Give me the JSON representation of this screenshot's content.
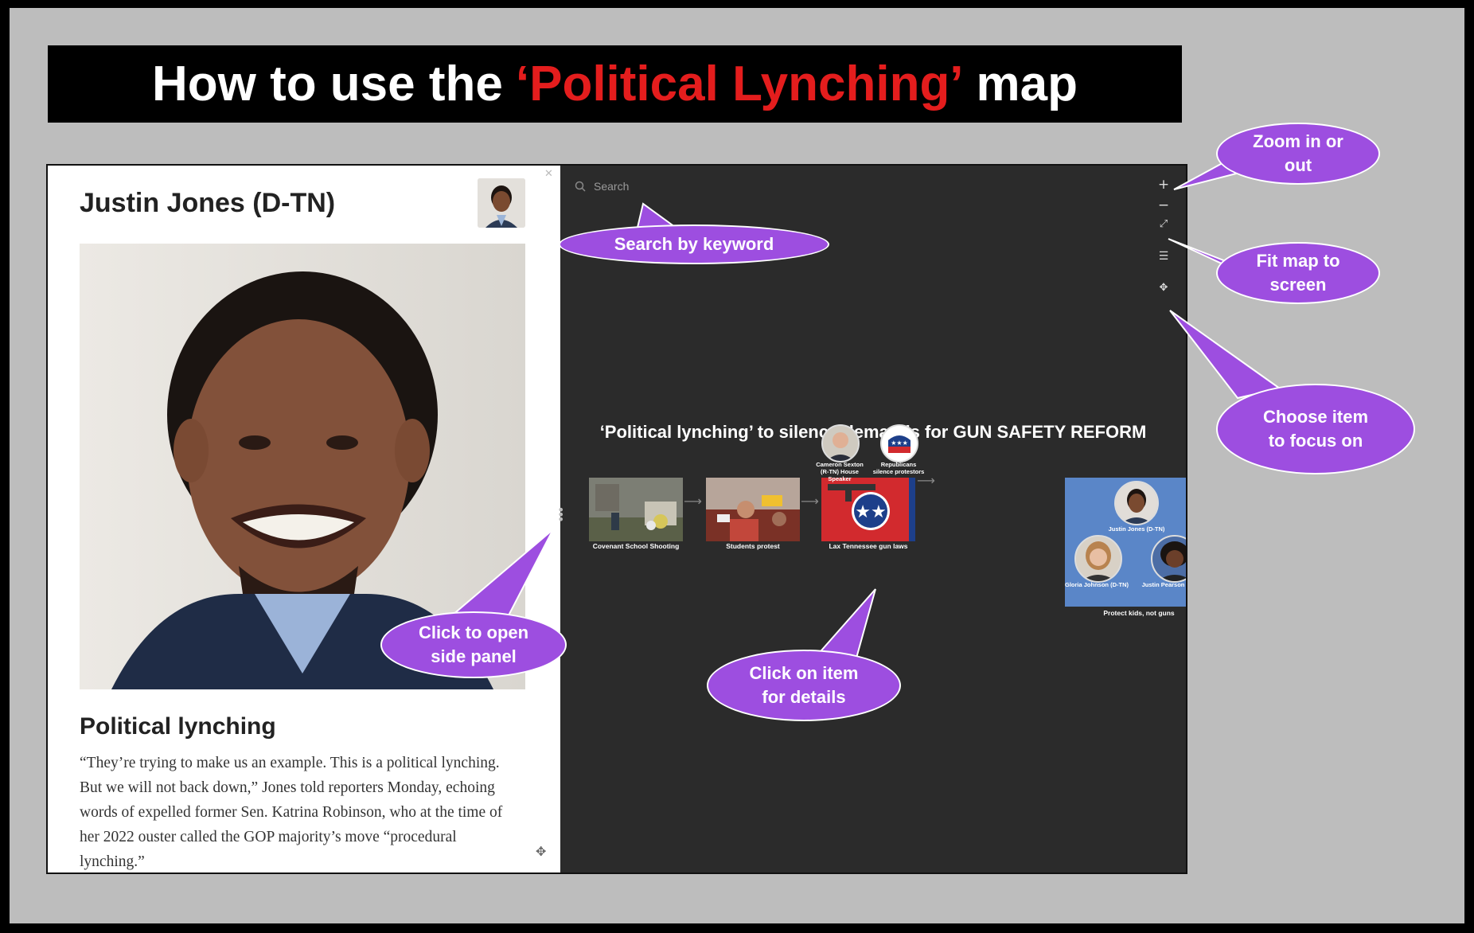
{
  "banner": {
    "prefix": "How to use the",
    "highlight": "‘Political Lynching’",
    "suffix": "map"
  },
  "side_panel": {
    "name": "Justin Jones (D-TN)",
    "close_icon": "close-icon",
    "section_title": "Political lynching",
    "quote": "“They’re trying to make us an example. This is a political lynching. But we will not back down,” Jones told reporters Monday, echoing words of expelled former Sen. Katrina Robinson, who at the time of her 2022 ouster called the GOP majority’s move “procedural lynching.”"
  },
  "map": {
    "search_placeholder": "Search",
    "tools": [
      "zoom-in-icon",
      "zoom-out-icon",
      "fit-screen-icon",
      "filter-icon",
      "focus-icon"
    ],
    "title": "‘Political lynching’ to silence demands for GUN SAFETY REFORM",
    "nodes": [
      {
        "caption": "Covenant School Shooting"
      },
      {
        "caption": "Students protest"
      },
      {
        "caption": "Lax Tennessee gun laws"
      },
      {
        "caption": "Protect kids, not guns"
      }
    ],
    "people": [
      {
        "caption": "Cameron Sexton (R-TN) House Speaker"
      },
      {
        "caption": "Republicans silence protestors"
      },
      {
        "caption": "Justin Jones (D-TN)"
      },
      {
        "caption": "Gloria Johnson (D-TN)"
      },
      {
        "caption": "Justin Pearson (D-TN)"
      }
    ]
  },
  "callouts": {
    "search": "Search by keyword",
    "zoom": "Zoom in or out",
    "fit": "Fit map to screen",
    "focus": "Choose item to focus on",
    "side_panel": "Click to open side panel",
    "details": "Click on item for details"
  },
  "colors": {
    "highlight": "#e41d1d",
    "callout": "#9d4ee0",
    "map_bg": "#2b2b2b",
    "group_bg": "#5a86c8"
  }
}
